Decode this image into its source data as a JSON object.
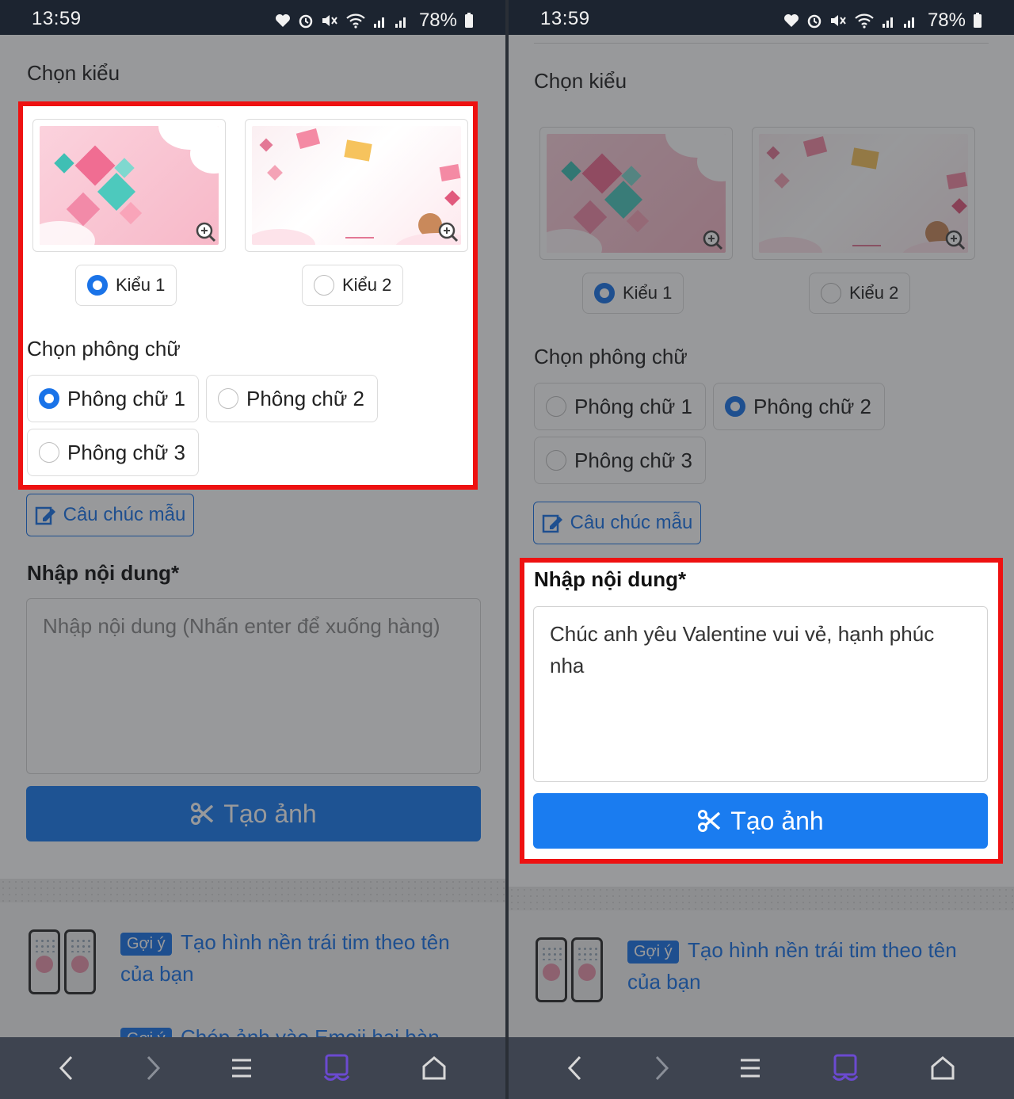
{
  "status_bar": {
    "time": "13:59",
    "battery": "78%"
  },
  "form": {
    "choose_style_label": "Chọn kiểu",
    "styles": [
      {
        "label": "Kiểu 1"
      },
      {
        "label": "Kiểu 2"
      }
    ],
    "choose_font_label": "Chọn phông chữ",
    "fonts": [
      {
        "label": "Phông chữ 1"
      },
      {
        "label": "Phông chữ 2"
      },
      {
        "label": "Phông chữ 3"
      }
    ],
    "sample_button": "Câu chúc mẫu",
    "content_label": "Nhập nội dung*",
    "content_placeholder": "Nhập nội dung (Nhấn enter để xuống hàng)",
    "create_button": "Tạo ảnh"
  },
  "left_screen": {
    "selected_style": "Kiểu 1",
    "selected_font": "Phông chữ 1",
    "content_value": ""
  },
  "right_screen": {
    "selected_style": "Kiểu 1",
    "selected_font": "Phông chữ 2",
    "content_value": "Chúc anh yêu Valentine vui vẻ, hạnh phúc nha"
  },
  "suggestions": [
    {
      "tag": "Gợi ý",
      "title": "Tạo hình nền trái tim theo tên của bạn"
    },
    {
      "tag": "Gợi ý",
      "title": "Chép ảnh vào Emoji hai bàn"
    }
  ],
  "colors": {
    "accent": "#1a73e8",
    "highlight": "#ee1111",
    "button": "#1a7cf0"
  },
  "nav_icons": [
    "back-icon",
    "forward-icon",
    "menu-icon",
    "tab-switcher-icon",
    "home-icon"
  ]
}
